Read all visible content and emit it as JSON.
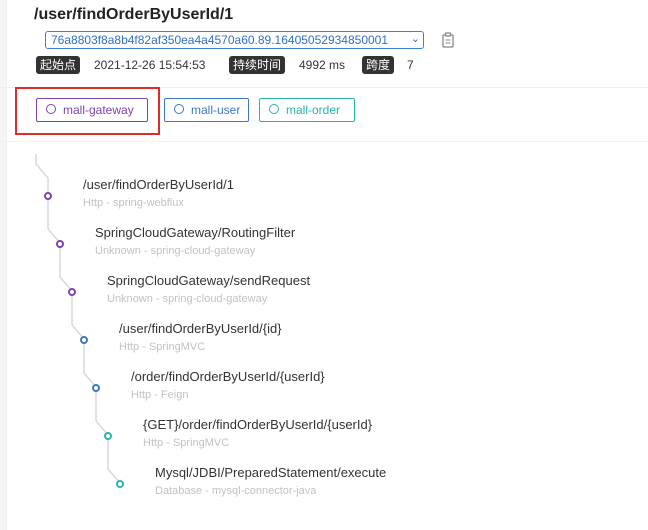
{
  "header": {
    "title": "/user/findOrderByUserId/1",
    "trace_id": "76a8803f8a8b4f82af350ea4a4570a60.89.16405052934850001",
    "start_label": "起始点",
    "start_value": "2021-12-26 15:54:53",
    "duration_label": "持续时间",
    "duration_value": "4992 ms",
    "span_label": "跨度",
    "span_value": "7"
  },
  "services": [
    {
      "name": "mall-gateway",
      "color": "#7b43b5"
    },
    {
      "name": "mall-user",
      "color": "#3b78c8"
    },
    {
      "name": "mall-order",
      "color": "#27b5ad"
    }
  ],
  "spans": [
    {
      "name": "/user/findOrderByUserId/1",
      "sub": "Http - spring-webflux",
      "color": "#7b43b5"
    },
    {
      "name": "SpringCloudGateway/RoutingFilter",
      "sub": "Unknown - spring-cloud-gateway",
      "color": "#7b43b5"
    },
    {
      "name": "SpringCloudGateway/sendRequest",
      "sub": "Unknown - spring-cloud-gateway",
      "color": "#7b43b5"
    },
    {
      "name": "/user/findOrderByUserId/{id}",
      "sub": "Http - SpringMVC",
      "color": "#3b78c8"
    },
    {
      "name": "/order/findOrderByUserId/{userId}",
      "sub": "Http - Feign",
      "color": "#3b78c8"
    },
    {
      "name": "{GET}/order/findOrderByUserId/{userId}",
      "sub": "Http - SpringMVC",
      "color": "#27b5ad"
    },
    {
      "name": "Mysql/JDBI/PreparedStatement/execute",
      "sub": "Database - mysql-connector-java",
      "color": "#27b5ad"
    }
  ]
}
